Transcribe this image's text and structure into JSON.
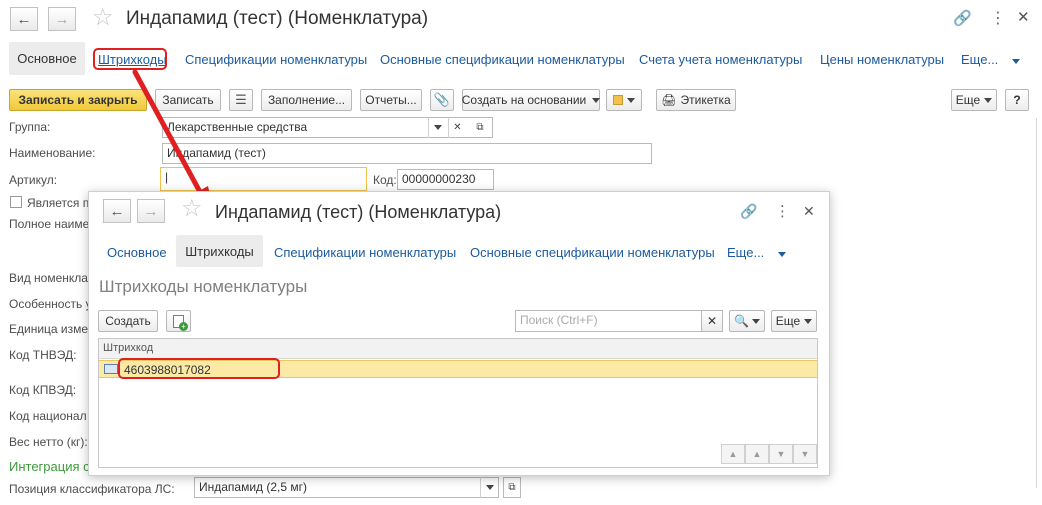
{
  "main": {
    "title": "Индапамид (тест) (Номенклатура)",
    "tabs": {
      "osnovnoe": "Основное",
      "barcodes": "Штрихкоды",
      "specs": "Спецификации номенклатуры",
      "main_specs": "Основные спецификации номенклатуры",
      "accounts": "Счета учета номенклатуры",
      "prices": "Цены номенклатуры",
      "more": "Еще..."
    },
    "toolbar": {
      "save_close": "Записать и закрыть",
      "save": "Записать",
      "fill": "Заполнение...",
      "reports": "Отчеты...",
      "create_based": "Создать на основании",
      "label": "Этикетка",
      "more": "Еще",
      "help": "?"
    },
    "fields": {
      "group_label": "Группа:",
      "group_value": "Лекарственные средства",
      "name_label": "Наименование:",
      "name_value": "Индапамид (тест)",
      "article_label": "Артикул:",
      "article_value": "|",
      "code_label": "Код:",
      "code_value": "00000000230",
      "is_checkbox_label": "Является пр",
      "full_name_label": "Полное наимен",
      "kind_label": "Вид номенкла",
      "feature_label": "Особенность уч",
      "unit_label": "Единица измер",
      "tnved_label": "Код ТНВЭД:",
      "kpvad_label": "Код КПВЭД:",
      "national_label": "Код национал",
      "weight_label": "Вес нетто (кг):",
      "integration_label": "Интеграция с",
      "classifier_label": "Позиция классификатора ЛС:",
      "classifier_value": "Индапамид (2,5 мг)"
    }
  },
  "popup": {
    "title": "Индапамид (тест) (Номенклатура)",
    "tabs": {
      "osnovnoe": "Основное",
      "barcodes": "Штрихкоды",
      "specs": "Спецификации номенклатуры",
      "main_specs": "Основные спецификации номенклатуры",
      "more": "Еще..."
    },
    "section_title": "Штрихкоды номенклатуры",
    "create_button": "Создать",
    "search_placeholder": "Поиск (Ctrl+F)",
    "more_button": "Еще",
    "column_header": "Штрихкод",
    "rows": [
      "4603988017082"
    ]
  },
  "colors": {
    "accent_yellow": "#f5d64a",
    "link_blue": "#1b5a9e",
    "highlight_red": "#e02020",
    "row_selected": "#fbe9a6",
    "integration_green": "#3c9a3c"
  }
}
